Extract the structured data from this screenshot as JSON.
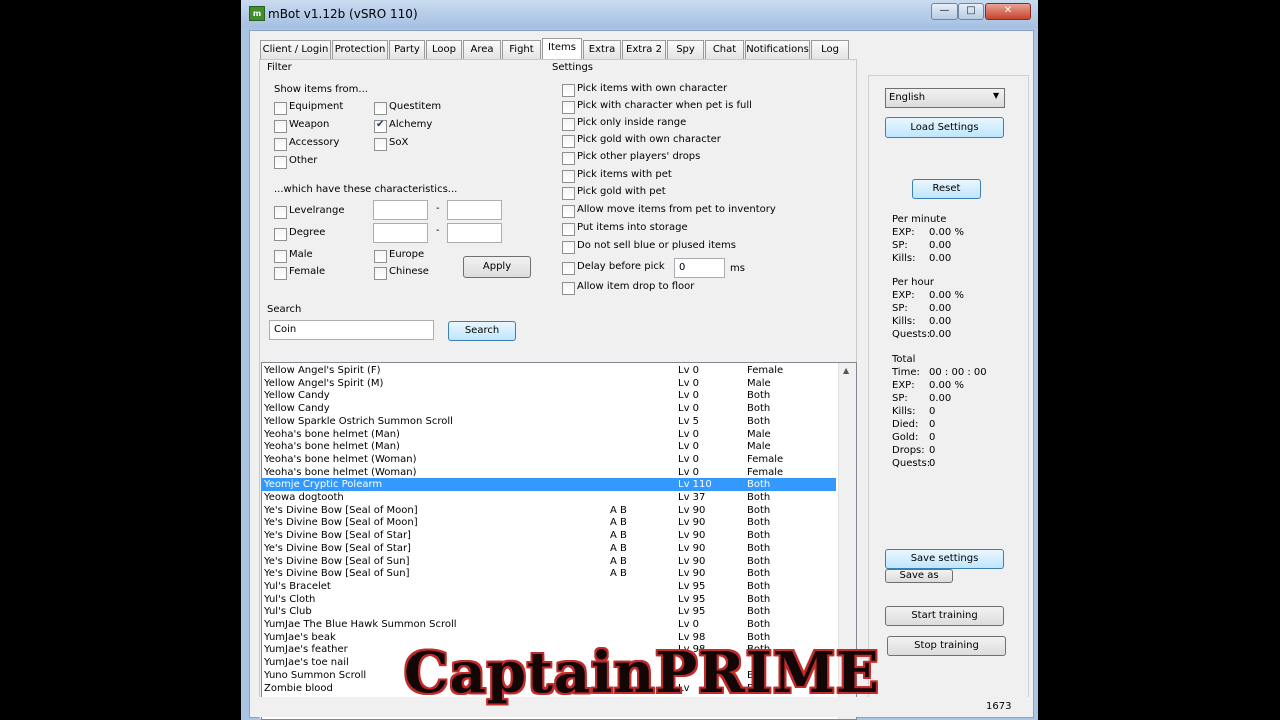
{
  "window": {
    "title": "mBot v1.12b (vSRO 110)",
    "icon_text": "m",
    "min_label": "—",
    "max_label": "□",
    "close_label": "✕"
  },
  "tabs": [
    "Client / Login",
    "Protection",
    "Party",
    "Loop",
    "Area",
    "Fight",
    "Items",
    "Extra",
    "Extra 2",
    "Spy",
    "Chat",
    "Notifications",
    "Log"
  ],
  "active_tab": "Items",
  "filter": {
    "title": "Filter",
    "show_label": "Show items from...",
    "left_types": [
      {
        "label": "Equipment",
        "checked": false
      },
      {
        "label": "Weapon",
        "checked": false
      },
      {
        "label": "Accessory",
        "checked": false
      },
      {
        "label": "Other",
        "checked": false
      }
    ],
    "right_types": [
      {
        "label": "Questitem",
        "checked": false
      },
      {
        "label": "Alchemy",
        "checked": true
      },
      {
        "label": "SoX",
        "checked": false
      }
    ],
    "char_label": "...which have these characteristics...",
    "levelrange_label": "Levelrange",
    "degree_label": "Degree",
    "dash": "-",
    "male_label": "Male",
    "female_label": "Female",
    "europe_label": "Europe",
    "chinese_label": "Chinese",
    "apply_label": "Apply"
  },
  "search": {
    "title": "Search",
    "value": "Coin",
    "button_label": "Search"
  },
  "settings": {
    "title": "Settings",
    "options": [
      "Pick items with own character",
      "Pick with character when pet is full",
      "Pick only inside range",
      "Pick gold with own character",
      "Pick other players' drops",
      "Pick items with pet",
      "Pick gold with pet",
      "Allow move items from pet to inventory",
      "Put items into storage",
      "Do not sell blue or plused items",
      "Delay before pick",
      "Allow item drop to floor"
    ],
    "delay_value": "0",
    "delay_unit": "ms"
  },
  "items": [
    {
      "name": "Yellow Angel's Spirit (F)",
      "tags": "",
      "level": "Lv 0",
      "gender": "Female"
    },
    {
      "name": "Yellow Angel's Spirit (M)",
      "tags": "",
      "level": "Lv 0",
      "gender": "Male"
    },
    {
      "name": "Yellow Candy",
      "tags": "",
      "level": "Lv 0",
      "gender": "Both"
    },
    {
      "name": "Yellow Candy",
      "tags": "",
      "level": "Lv 0",
      "gender": "Both"
    },
    {
      "name": "Yellow Sparkle Ostrich Summon Scroll",
      "tags": "",
      "level": "Lv 5",
      "gender": "Both"
    },
    {
      "name": "Yeoha's bone helmet (Man)",
      "tags": "",
      "level": "Lv 0",
      "gender": "Male"
    },
    {
      "name": "Yeoha's bone helmet (Man)",
      "tags": "",
      "level": "Lv 0",
      "gender": "Male"
    },
    {
      "name": "Yeoha's bone helmet (Woman)",
      "tags": "",
      "level": "Lv 0",
      "gender": "Female"
    },
    {
      "name": "Yeoha's bone helmet (Woman)",
      "tags": "",
      "level": "Lv 0",
      "gender": "Female"
    },
    {
      "name": "Yeomje Cryptic Polearm",
      "tags": "",
      "level": "Lv 110",
      "gender": "Both",
      "selected": true
    },
    {
      "name": "Yeowa dogtooth",
      "tags": "",
      "level": "Lv 37",
      "gender": "Both"
    },
    {
      "name": "Ye's Divine Bow [Seal of Moon]",
      "tags": "A B",
      "level": "Lv 90",
      "gender": "Both"
    },
    {
      "name": "Ye's Divine Bow [Seal of Moon]",
      "tags": "A B",
      "level": "Lv 90",
      "gender": "Both"
    },
    {
      "name": "Ye's Divine Bow [Seal of Star]",
      "tags": "A B",
      "level": "Lv 90",
      "gender": "Both"
    },
    {
      "name": "Ye's Divine Bow [Seal of Star]",
      "tags": "A B",
      "level": "Lv 90",
      "gender": "Both"
    },
    {
      "name": "Ye's Divine Bow [Seal of Sun]",
      "tags": "A B",
      "level": "Lv 90",
      "gender": "Both"
    },
    {
      "name": "Ye's Divine Bow [Seal of Sun]",
      "tags": "A B",
      "level": "Lv 90",
      "gender": "Both"
    },
    {
      "name": "Yul's Bracelet",
      "tags": "",
      "level": "Lv 95",
      "gender": "Both"
    },
    {
      "name": "Yul's Cloth",
      "tags": "",
      "level": "Lv 95",
      "gender": "Both"
    },
    {
      "name": "Yul's Club",
      "tags": "",
      "level": "Lv 95",
      "gender": "Both"
    },
    {
      "name": "YumJae The Blue Hawk Summon Scroll",
      "tags": "",
      "level": "Lv 0",
      "gender": "Both"
    },
    {
      "name": "YumJae's beak",
      "tags": "",
      "level": "Lv 98",
      "gender": "Both"
    },
    {
      "name": "YumJae's feather",
      "tags": "",
      "level": "Lv 98",
      "gender": "Both"
    },
    {
      "name": "YumJae's toe nail",
      "tags": "",
      "level": "",
      "gender": ""
    },
    {
      "name": "Yuno Summon Scroll",
      "tags": "",
      "level": "",
      "gender": "B"
    },
    {
      "name": "Zombie blood",
      "tags": "",
      "level": "Lv",
      "gender": "B"
    }
  ],
  "scroll_up": "▲",
  "scroll_down": "▼",
  "sidebar": {
    "language": "English",
    "load_label": "Load Settings",
    "reset_label": "Reset",
    "per_minute": {
      "title": "Per minute",
      "exp": "EXP:",
      "exp_val": "0.00 %",
      "sp": "SP:",
      "sp_val": "0.00",
      "kills": "Kills:",
      "kills_val": "0.00"
    },
    "per_hour": {
      "title": "Per hour",
      "exp": "EXP:",
      "exp_val": "0.00 %",
      "sp": "SP:",
      "sp_val": "0.00",
      "kills": "Kills:",
      "kills_val": "0.00",
      "quests": "Quests:",
      "quests_val": "0.00"
    },
    "total": {
      "title": "Total",
      "time": "Time:",
      "time_val": "00 : 00 : 00",
      "exp": "EXP:",
      "exp_val": "0.00 %",
      "sp": "SP:",
      "sp_val": "0.00",
      "kills": "Kills:",
      "kills_val": "0",
      "died": "Died:",
      "died_val": "0",
      "gold": "Gold:",
      "gold_val": "0",
      "drops": "Drops:",
      "drops_val": "0",
      "quests": "Quests:",
      "quests_val": "0"
    },
    "save_label": "Save settings",
    "save_as_label": "Save as",
    "start_label": "Start training",
    "stop_label": "Stop training"
  },
  "status_number": "1673",
  "watermark": "CaptainPRIME"
}
